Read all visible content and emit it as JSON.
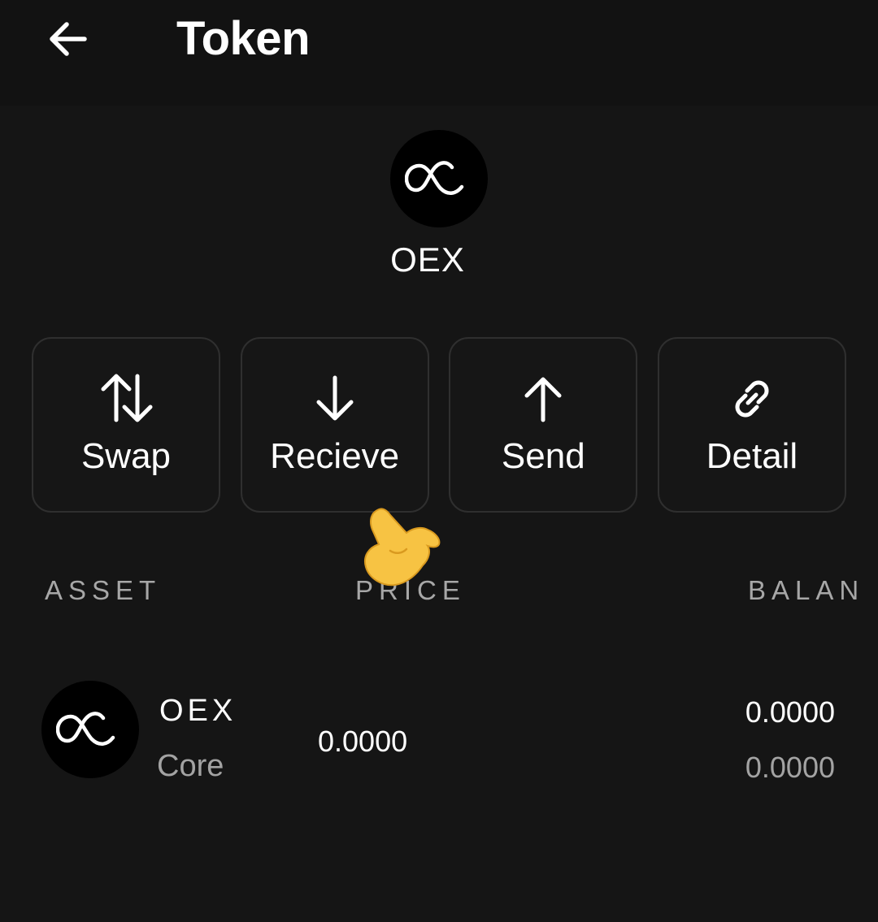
{
  "header": {
    "title": "Token"
  },
  "token": {
    "name": "OEX"
  },
  "actions": [
    {
      "label": "Swap",
      "icon": "swap-arrows-icon"
    },
    {
      "label": "Recieve",
      "icon": "arrow-down-icon"
    },
    {
      "label": "Send",
      "icon": "arrow-up-icon"
    },
    {
      "label": "Detail",
      "icon": "link-icon"
    }
  ],
  "table": {
    "headers": [
      "ASSET",
      "PRICE",
      "BALAN"
    ],
    "rows": [
      {
        "symbol": "OEX",
        "sub": "Core",
        "price": "0.0000",
        "balance": "0.0000",
        "balance_sub": "0.0000"
      }
    ]
  },
  "colors": {
    "background": "#151515",
    "header": "#121212",
    "button_border": "#2f2f2f",
    "muted": "#a3a3a3"
  }
}
